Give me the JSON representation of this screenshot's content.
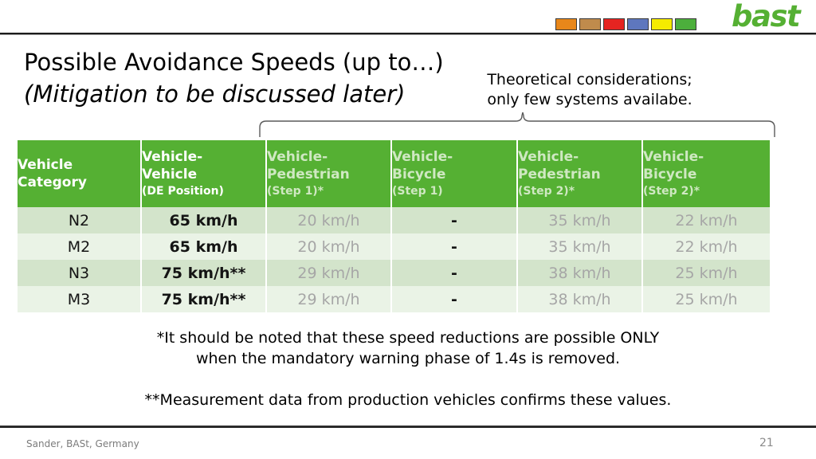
{
  "header": {
    "logo_text": "bast",
    "logo_color": "#55b033",
    "swatches": [
      {
        "name": "swatch-orange",
        "color": "#e8871a"
      },
      {
        "name": "swatch-tan",
        "color": "#c08b4c"
      },
      {
        "name": "swatch-red",
        "color": "#e52421"
      },
      {
        "name": "swatch-blue",
        "color": "#5e77be"
      },
      {
        "name": "swatch-yellow",
        "color": "#f5eb00"
      },
      {
        "name": "swatch-green",
        "color": "#4caf3c"
      }
    ]
  },
  "title": {
    "line1": "Possible Avoidance Speeds (up to…)",
    "line2": "(Mitigation to be discussed later)"
  },
  "annotation": {
    "line1": "Theoretical considerations;",
    "line2": "only few systems availabe."
  },
  "table": {
    "accent_color": "#55b033",
    "row_odd_color": "#d3e4cb",
    "row_even_color": "#eaf3e6",
    "dim_text_color": "#a6a6a6",
    "columns": [
      {
        "line1": "Vehicle",
        "line2": "Category",
        "sub": "",
        "dim": false
      },
      {
        "line1": "Vehicle-",
        "line2": "Vehicle",
        "sub": "(DE Position)",
        "dim": false
      },
      {
        "line1": "Vehicle-",
        "line2": "Pedestrian",
        "sub": "(Step 1)*",
        "dim": true
      },
      {
        "line1": "Vehicle-",
        "line2": "Bicycle",
        "sub": "(Step 1)",
        "dim": true
      },
      {
        "line1": "Vehicle-",
        "line2": "Pedestrian",
        "sub": "(Step 2)*",
        "dim": true
      },
      {
        "line1": "Vehicle-",
        "line2": "Bicycle",
        "sub": "(Step 2)*",
        "dim": true
      }
    ],
    "rows": [
      {
        "cells": [
          "N2",
          "65 km/h",
          "20 km/h",
          "-",
          "35 km/h",
          "22 km/h"
        ]
      },
      {
        "cells": [
          "M2",
          "65 km/h",
          "20 km/h",
          "-",
          "35 km/h",
          "22 km/h"
        ]
      },
      {
        "cells": [
          "N3",
          "75 km/h**",
          "29 km/h",
          "-",
          "38 km/h",
          "25 km/h"
        ]
      },
      {
        "cells": [
          "M3",
          "75 km/h**",
          "29 km/h",
          "-",
          "38 km/h",
          "25 km/h"
        ]
      }
    ]
  },
  "footnotes": {
    "note1_line1": "*It should be noted that these speed reductions are possible ONLY",
    "note1_line2": "when the mandatory warning phase of 1.4s is removed.",
    "note2": "**Measurement data from production vehicles confirms these values."
  },
  "footer": {
    "author": "Sander, BASt, Germany",
    "page_number": "21"
  }
}
